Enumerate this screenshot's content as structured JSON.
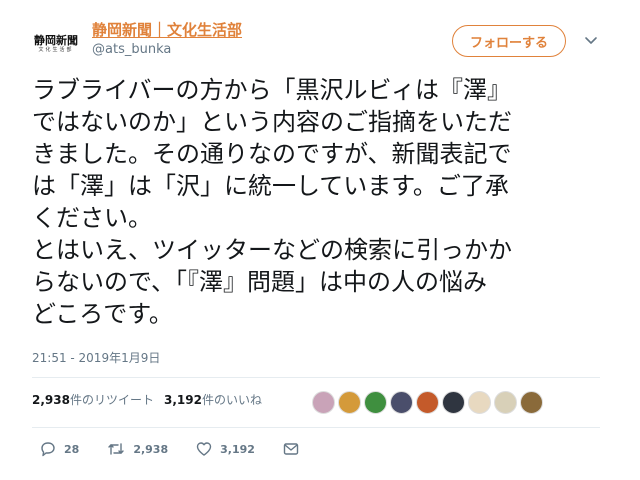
{
  "account": {
    "display_name": "静岡新聞｜文化生活部",
    "handle": "@ats_bunka",
    "avatar_logo": "静岡新聞",
    "avatar_sub": "文化生活部"
  },
  "follow_button": {
    "label": "フォローする"
  },
  "tweet": {
    "text": "ラブライバーの方から「黒沢ルビィは『澤』\nではないのか」という内容のご指摘をいただ\nきました。その通りなのですが、新聞表記で\nは「澤」は「沢」に統一しています。ご了承\nください。\nとはいえ、ツイッターなどの検索に引っかか\nらないので、「『澤』問題」は中の人の悩み\nどころです。",
    "timestamp": "21:51 - 2019年1月9日"
  },
  "stats": {
    "retweets_count": "2,938",
    "retweets_label": "件のリツイート",
    "likes_count": "3,192",
    "likes_label": "件のいいね"
  },
  "likers": {
    "colors": [
      "#c9a3b8",
      "#d49a3a",
      "#3f8f3f",
      "#4a4e6b",
      "#c45a2a",
      "#2f3540",
      "#e8d9c0",
      "#d8d0b8",
      "#8a6a3a"
    ]
  },
  "actions": {
    "reply_count": "28",
    "retweet_count": "2,938",
    "like_count": "3,192"
  },
  "colors": {
    "brand": "#e0823b",
    "muted": "#657786",
    "divider": "#e6ecf0"
  }
}
